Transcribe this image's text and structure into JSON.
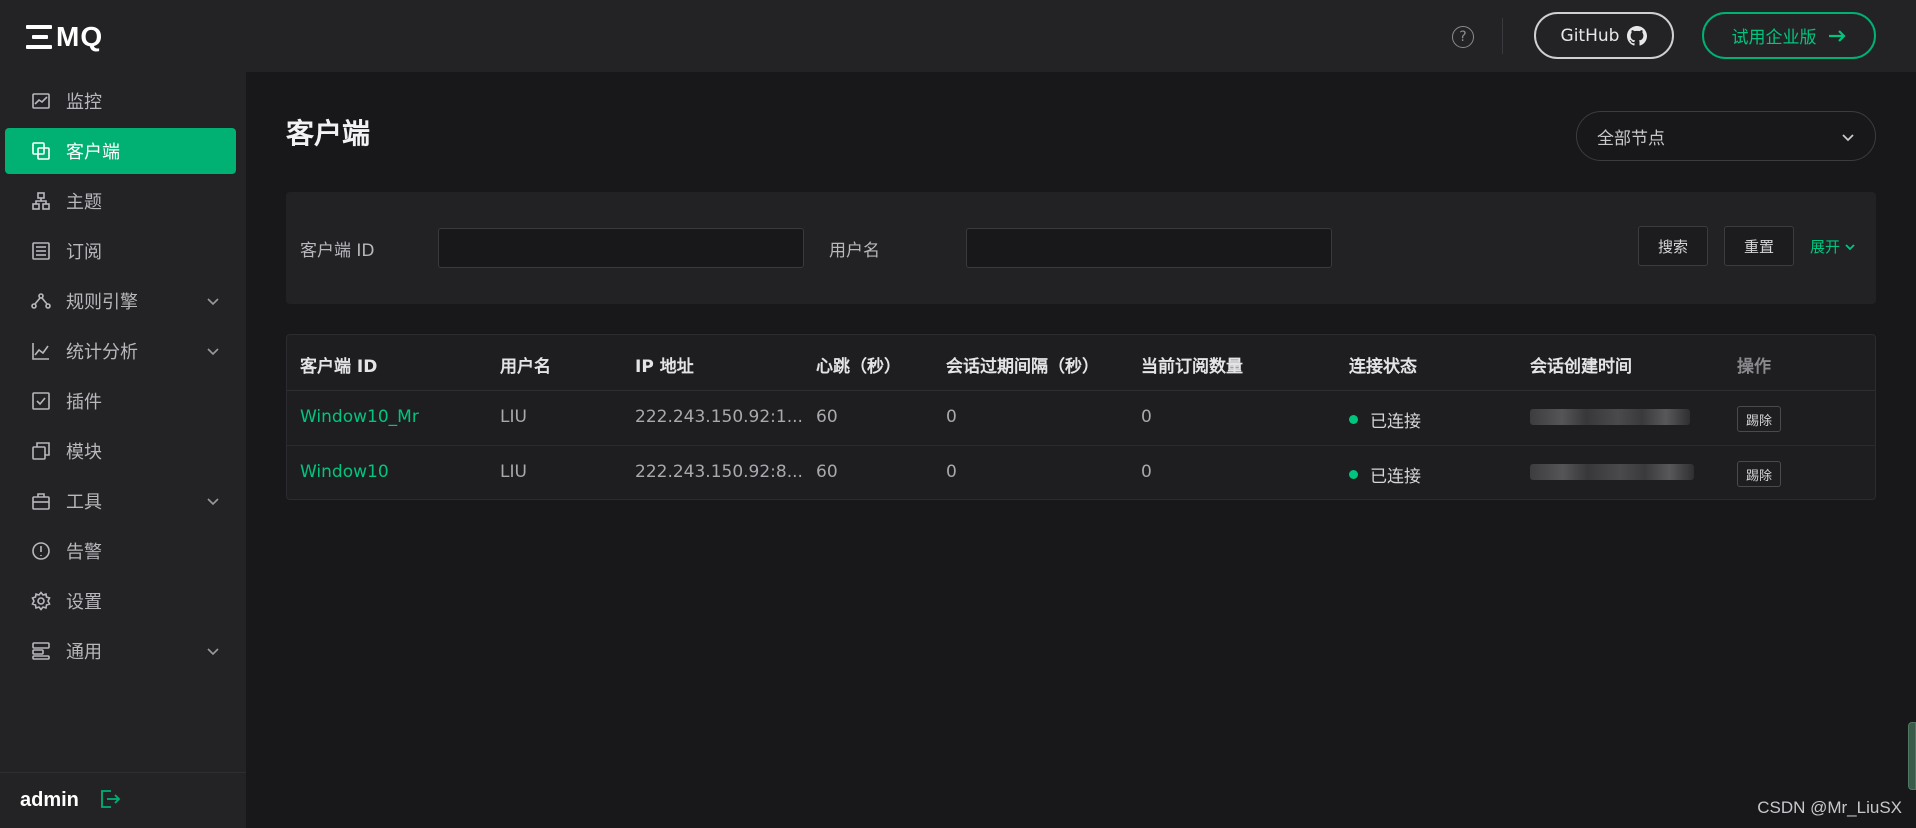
{
  "brand": {
    "logo_text": "MQ",
    "accent": "#00b173"
  },
  "sidebar": {
    "items": [
      {
        "label": "监控",
        "icon": "chart-line-icon"
      },
      {
        "label": "客户端",
        "icon": "clients-icon"
      },
      {
        "label": "主题",
        "icon": "topic-tree-icon"
      },
      {
        "label": "订阅",
        "icon": "subscription-list-icon"
      },
      {
        "label": "规则引擎",
        "icon": "rule-engine-icon"
      },
      {
        "label": "统计分析",
        "icon": "analytics-icon"
      },
      {
        "label": "插件",
        "icon": "plugin-check-icon"
      },
      {
        "label": "模块",
        "icon": "modules-icon"
      },
      {
        "label": "工具",
        "icon": "toolbox-icon"
      },
      {
        "label": "告警",
        "icon": "alert-icon"
      },
      {
        "label": "设置",
        "icon": "gear-icon"
      },
      {
        "label": "通用",
        "icon": "general-icon"
      }
    ],
    "active_index": 1,
    "user": "admin"
  },
  "header": {
    "help": "?",
    "github_label": "GitHub",
    "trial_label": "试用企业版"
  },
  "page": {
    "title": "客户端",
    "node_select": "全部节点"
  },
  "filter": {
    "client_id_label": "客户端 ID",
    "username_label": "用户名",
    "search_label": "搜索",
    "reset_label": "重置",
    "expand_label": "展开"
  },
  "table": {
    "columns": [
      "客户端 ID",
      "用户名",
      "IP 地址",
      "心跳（秒）",
      "会话过期间隔（秒）",
      "当前订阅数量",
      "连接状态",
      "会话创建时间",
      "操作"
    ],
    "rows": [
      {
        "client_id": "Window10_Mr",
        "username": "LIU",
        "ip": "222.243.150.92:1...",
        "keepalive": "60",
        "expiry": "0",
        "subs": "0",
        "status": "已连接",
        "action": "踢除"
      },
      {
        "client_id": "Window10",
        "username": "LIU",
        "ip": "222.243.150.92:8...",
        "keepalive": "60",
        "expiry": "0",
        "subs": "0",
        "status": "已连接",
        "action": "踢除"
      }
    ]
  },
  "watermark": "CSDN @Mr_LiuSX"
}
